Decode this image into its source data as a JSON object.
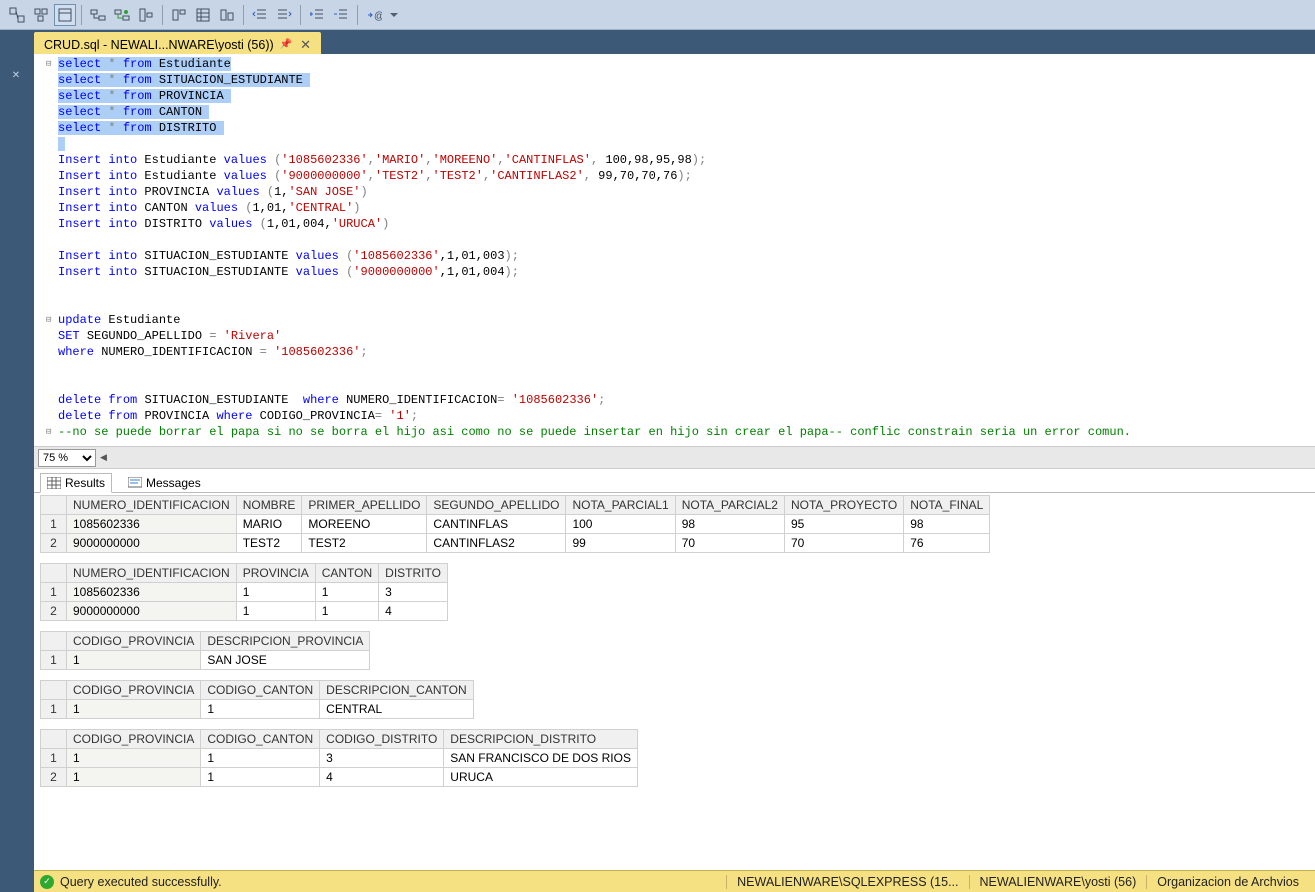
{
  "tab": {
    "title": "CRUD.sql - NEWALI...NWARE\\yosti (56))"
  },
  "zoom": {
    "value": "75 %"
  },
  "resultsTabs": {
    "results": "Results",
    "messages": "Messages"
  },
  "editor": {
    "selects": [
      {
        "table": "Estudiante"
      },
      {
        "table": "SITUACION_ESTUDIANTE"
      },
      {
        "table": "PROVINCIA"
      },
      {
        "table": "CANTON"
      },
      {
        "table": "DISTRITO"
      }
    ],
    "inserts": {
      "est1": {
        "id": "'1085602336'",
        "n1": "'MARIO'",
        "n2": "'MOREENO'",
        "n3": "'CANTINFLAS'",
        "nums": " 100,98,95,98"
      },
      "est2": {
        "id": "'9000000000'",
        "n1": "'TEST2'",
        "n2": "'TEST2'",
        "n3": "'CANTINFLAS2'",
        "nums": " 99,70,70,76"
      },
      "prov": {
        "args_pre": "1,",
        "str": "'SAN JOSE'"
      },
      "canton": {
        "args_pre": "1,01,",
        "str": "'CENTRAL'"
      },
      "distrito": {
        "args_pre": "1,01,004,",
        "str": "'URUCA'"
      },
      "sit1": {
        "id": "'1085602336'",
        "rest": ",1,01,003"
      },
      "sit2": {
        "id": "'9000000000'",
        "rest": ",1,01,004"
      }
    },
    "update": {
      "tbl": "Estudiante",
      "col": "SEGUNDO_APELLIDO",
      "val": "'Rivera'",
      "wcol": "NUMERO_IDENTIFICACION",
      "wval": "'1085602336'"
    },
    "deletes": {
      "d1": {
        "tbl": "SITUACION_ESTUDIANTE",
        "wcol": "NUMERO_IDENTIFICACION",
        "wval": "'1085602336'"
      },
      "d2": {
        "tbl": "PROVINCIA",
        "wcol": "CODIGO_PROVINCIA",
        "wval": "'1'"
      }
    },
    "comment": "--no se puede borrar el papa si no se borra el hijo asi como no se puede insertar en hijo sin crear el papa-- conflic constrain seria un error comun."
  },
  "grids": {
    "g1": {
      "headers": [
        "NUMERO_IDENTIFICACION",
        "NOMBRE",
        "PRIMER_APELLIDO",
        "SEGUNDO_APELLIDO",
        "NOTA_PARCIAL1",
        "NOTA_PARCIAL2",
        "NOTA_PROYECTO",
        "NOTA_FINAL"
      ],
      "rows": [
        [
          "1085602336",
          "MARIO",
          "MOREENO",
          "CANTINFLAS",
          "100",
          "98",
          "95",
          "98"
        ],
        [
          "9000000000",
          "TEST2",
          "TEST2",
          "CANTINFLAS2",
          "99",
          "70",
          "70",
          "76"
        ]
      ]
    },
    "g2": {
      "headers": [
        "NUMERO_IDENTIFICACION",
        "PROVINCIA",
        "CANTON",
        "DISTRITO"
      ],
      "rows": [
        [
          "1085602336",
          "1",
          "1",
          "3"
        ],
        [
          "9000000000",
          "1",
          "1",
          "4"
        ]
      ]
    },
    "g3": {
      "headers": [
        "CODIGO_PROVINCIA",
        "DESCRIPCION_PROVINCIA"
      ],
      "rows": [
        [
          "1",
          "SAN JOSE"
        ]
      ]
    },
    "g4": {
      "headers": [
        "CODIGO_PROVINCIA",
        "CODIGO_CANTON",
        "DESCRIPCION_CANTON"
      ],
      "rows": [
        [
          "1",
          "1",
          "CENTRAL"
        ]
      ]
    },
    "g5": {
      "headers": [
        "CODIGO_PROVINCIA",
        "CODIGO_CANTON",
        "CODIGO_DISTRITO",
        "DESCRIPCION_DISTRITO"
      ],
      "rows": [
        [
          "1",
          "1",
          "3",
          "SAN FRANCISCO DE DOS RIOS"
        ],
        [
          "1",
          "1",
          "4",
          "URUCA"
        ]
      ]
    }
  },
  "status": {
    "msg": "Query executed successfully.",
    "server": "NEWALIENWARE\\SQLEXPRESS (15...",
    "user": "NEWALIENWARE\\yosti (56)",
    "db": "Organizacion de Archvios"
  },
  "kw": {
    "select": "select",
    "from": "from",
    "insert": "Insert",
    "into": "into",
    "values": "values",
    "update": "update",
    "set": "SET",
    "where": "where",
    "delete": "delete"
  }
}
